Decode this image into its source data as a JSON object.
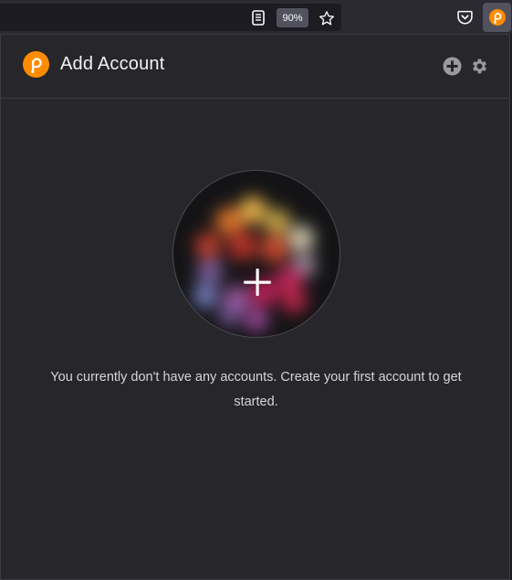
{
  "browser": {
    "zoom_level": "90%",
    "icons": [
      "reader-view-icon",
      "star-icon",
      "pocket-icon",
      "extension-logo-icon"
    ]
  },
  "popup": {
    "title": "Add Account",
    "empty_message": "You currently don't have any accounts. Create your first account to get started.",
    "icons": [
      "brand-logo-icon",
      "add-account-icon",
      "settings-icon",
      "create-account-plus-icon"
    ]
  },
  "colors": {
    "accent": "#ff8c00",
    "background": "#26262b",
    "text": "#f2f2f2",
    "icon": "#9b9b9f"
  }
}
